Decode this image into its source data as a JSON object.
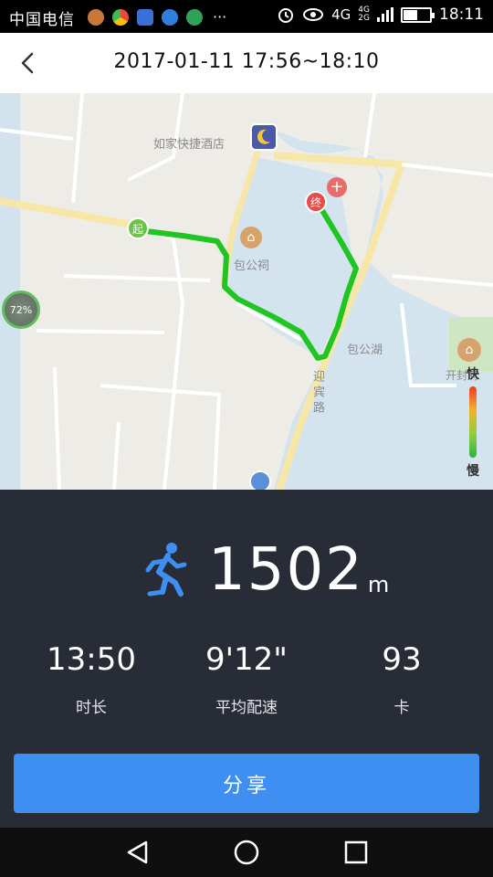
{
  "status_bar": {
    "carrier": "中国电信",
    "more": "···",
    "network_top": "4G",
    "network_bottom": "2G",
    "network_main": "4G",
    "time": "18:11",
    "battery_level": 0.55
  },
  "header": {
    "title": "2017-01-11 17:56~18:10",
    "back_icon": "chevron-left-icon"
  },
  "map": {
    "labels": {
      "hotel": "如家快捷酒店",
      "shrine": "包公祠",
      "lake": "包公湖",
      "road": "迎宾路",
      "kaifeng": "开封府"
    },
    "start_marker": "起",
    "end_marker": "终",
    "speed_fast": "快",
    "speed_slow": "慢",
    "battery_badge": "72%",
    "route_color": "#21c521"
  },
  "stats": {
    "distance_value": "1502",
    "distance_unit": "m",
    "duration_value": "13:50",
    "duration_label": "时长",
    "pace_value": "9'12\"",
    "pace_label": "平均配速",
    "calories_value": "93",
    "calories_label": "卡"
  },
  "actions": {
    "share_label": "分享"
  },
  "colors": {
    "panel_bg": "#272c36",
    "accent": "#3f8ff2"
  }
}
